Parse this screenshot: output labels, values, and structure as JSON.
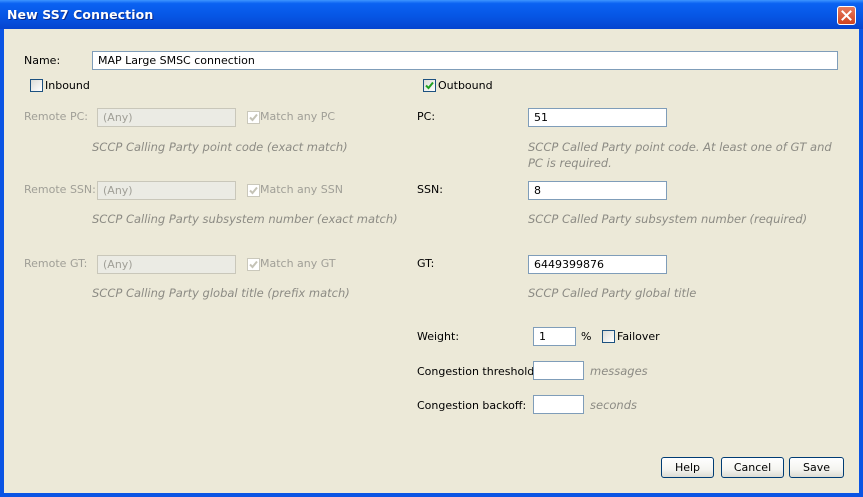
{
  "window": {
    "title": "New SS7 Connection",
    "close_icon": "close-icon"
  },
  "name": {
    "label": "Name:",
    "value": "MAP Large SMSC connection"
  },
  "inbound": {
    "label": "Inbound",
    "checked": false,
    "remote_pc": {
      "label": "Remote PC:",
      "value": "(Any)",
      "match_label": "Match any PC",
      "match_checked": true,
      "description": "SCCP Calling Party point code (exact match)"
    },
    "remote_ssn": {
      "label": "Remote SSN:",
      "value": "(Any)",
      "match_label": "Match any SSN",
      "match_checked": true,
      "description": "SCCP Calling Party subsystem number (exact match)"
    },
    "remote_gt": {
      "label": "Remote GT:",
      "value": "(Any)",
      "match_label": "Match any GT",
      "match_checked": true,
      "description": "SCCP Calling Party global title (prefix match)"
    }
  },
  "outbound": {
    "label": "Outbound",
    "checked": true,
    "pc": {
      "label": "PC:",
      "value": "51",
      "description": "SCCP Called Party point code. At least one of GT and PC is required."
    },
    "ssn": {
      "label": "SSN:",
      "value": "8",
      "description": "SCCP Called Party subsystem number (required)"
    },
    "gt": {
      "label": "GT:",
      "value": "6449399876",
      "description": "SCCP Called Party global title"
    },
    "weight": {
      "label": "Weight:",
      "value": "1",
      "unit": "%"
    },
    "failover": {
      "label": "Failover",
      "checked": false
    },
    "congestion_threshold": {
      "label": "Congestion threshold:",
      "value": "",
      "unit": "messages"
    },
    "congestion_backoff": {
      "label": "Congestion backoff:",
      "value": "",
      "unit": "seconds"
    }
  },
  "buttons": {
    "help": "Help",
    "cancel": "Cancel",
    "save": "Save"
  }
}
